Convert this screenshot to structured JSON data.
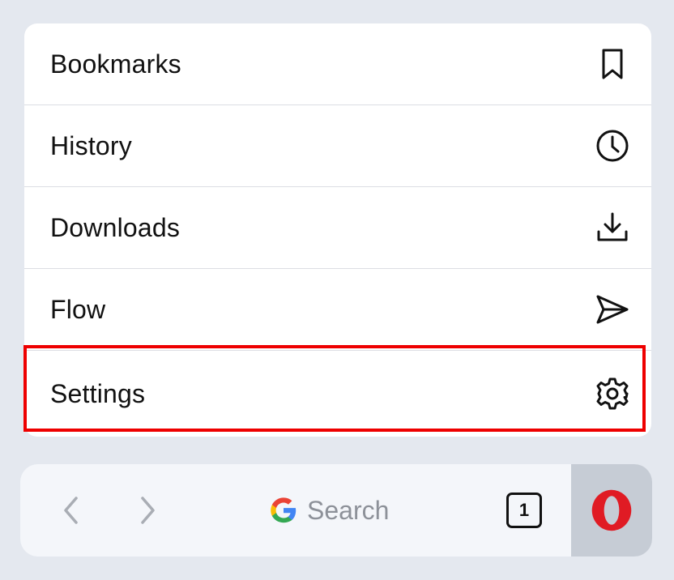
{
  "menu": {
    "items": [
      {
        "label": "Bookmarks",
        "icon": "bookmark-icon"
      },
      {
        "label": "History",
        "icon": "clock-icon"
      },
      {
        "label": "Downloads",
        "icon": "download-icon"
      },
      {
        "label": "Flow",
        "icon": "send-icon"
      },
      {
        "label": "Settings",
        "icon": "gear-icon"
      }
    ]
  },
  "bottom_bar": {
    "search_label": "Search",
    "tab_count": "1"
  },
  "colors": {
    "highlight": "#ee0000",
    "opera_red": "#e01b24",
    "background": "#e4e8ef"
  }
}
